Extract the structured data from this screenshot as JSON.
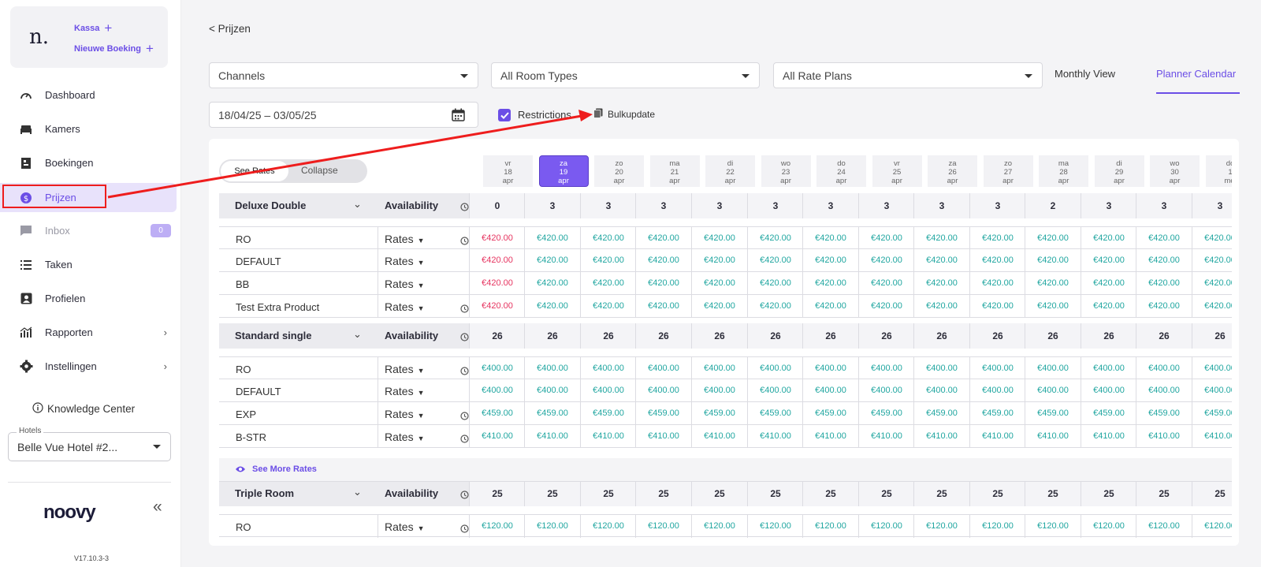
{
  "sidebar": {
    "quick_kassa": "Kassa",
    "quick_booking": "Nieuwe Boeking",
    "logo_letter": "n.",
    "items": [
      {
        "label": "Dashboard",
        "icon": "gauge-icon"
      },
      {
        "label": "Kamers",
        "icon": "bed-icon"
      },
      {
        "label": "Boekingen",
        "icon": "bookings-icon"
      },
      {
        "label": "Prijzen",
        "icon": "coin-icon"
      },
      {
        "label": "Inbox",
        "icon": "chat-icon",
        "badge": "0"
      },
      {
        "label": "Taken",
        "icon": "list-icon"
      },
      {
        "label": "Profielen",
        "icon": "profile-icon"
      },
      {
        "label": "Rapporten",
        "icon": "chart-icon"
      },
      {
        "label": "Instellingen",
        "icon": "gear-icon"
      }
    ],
    "knowledge": "Knowledge Center",
    "hotel_label": "Hotels",
    "hotel_value": "Belle Vue Hotel #2...",
    "brand": "noovy",
    "version": "V17.10.3-3"
  },
  "back_link": "< Prijzen",
  "filters": {
    "channels": "Channels",
    "room_types": "All Room Types",
    "rate_plans": "All Rate Plans",
    "monthly_view": "Monthly View",
    "planner_calendar": "Planner Calendar",
    "date_range": "18/04/25 – 03/05/25",
    "restrictions": "Restrictions",
    "bulkupdate": "Bulkupdate"
  },
  "toggle": {
    "see_rates": "See Rates",
    "collapse": "Collapse"
  },
  "days": [
    {
      "dow": "vr",
      "d": "18",
      "m": "apr"
    },
    {
      "dow": "za",
      "d": "19",
      "m": "apr"
    },
    {
      "dow": "zo",
      "d": "20",
      "m": "apr"
    },
    {
      "dow": "ma",
      "d": "21",
      "m": "apr"
    },
    {
      "dow": "di",
      "d": "22",
      "m": "apr"
    },
    {
      "dow": "wo",
      "d": "23",
      "m": "apr"
    },
    {
      "dow": "do",
      "d": "24",
      "m": "apr"
    },
    {
      "dow": "vr",
      "d": "25",
      "m": "apr"
    },
    {
      "dow": "za",
      "d": "26",
      "m": "apr"
    },
    {
      "dow": "zo",
      "d": "27",
      "m": "apr"
    },
    {
      "dow": "ma",
      "d": "28",
      "m": "apr"
    },
    {
      "dow": "di",
      "d": "29",
      "m": "apr"
    },
    {
      "dow": "wo",
      "d": "30",
      "m": "apr"
    },
    {
      "dow": "do",
      "d": "1",
      "m": "mei"
    }
  ],
  "availability_label": "Availability",
  "rates_label": "Rates",
  "see_more_rates": "See More Rates",
  "room_groups": [
    {
      "name": "Deluxe Double",
      "availability": [
        "0",
        "3",
        "3",
        "3",
        "3",
        "3",
        "3",
        "3",
        "3",
        "3",
        "2",
        "3",
        "3",
        "3"
      ],
      "rates": [
        {
          "name": "RO",
          "price": "€420.00",
          "first_red": true,
          "history": true
        },
        {
          "name": "DEFAULT",
          "price": "€420.00",
          "first_red": true,
          "history": false
        },
        {
          "name": "BB",
          "price": "€420.00",
          "first_red": true,
          "history": false
        },
        {
          "name": "Test Extra Product",
          "price": "€420.00",
          "first_red": true,
          "history": true
        }
      ]
    },
    {
      "name": "Standard single",
      "availability": [
        "26",
        "26",
        "26",
        "26",
        "26",
        "26",
        "26",
        "26",
        "26",
        "26",
        "26",
        "26",
        "26",
        "26"
      ],
      "rates": [
        {
          "name": "RO",
          "price": "€400.00",
          "first_red": false,
          "history": true
        },
        {
          "name": "DEFAULT",
          "price": "€400.00",
          "first_red": false,
          "history": false
        },
        {
          "name": "EXP",
          "price": "€459.00",
          "first_red": false,
          "history": true
        },
        {
          "name": "B-STR",
          "price": "€410.00",
          "first_red": false,
          "history": true
        }
      ]
    },
    {
      "name": "Triple Room",
      "availability": [
        "25",
        "25",
        "25",
        "25",
        "25",
        "25",
        "25",
        "25",
        "25",
        "25",
        "25",
        "25",
        "25",
        "25"
      ],
      "rates": [
        {
          "name": "RO",
          "price": "€120.00",
          "first_red": false,
          "history": true
        }
      ]
    }
  ],
  "colors": {
    "accent": "#6b4ee6",
    "price": "#20a6a0",
    "price_alert": "#e6335f",
    "annotation": "#ee1d1d"
  }
}
